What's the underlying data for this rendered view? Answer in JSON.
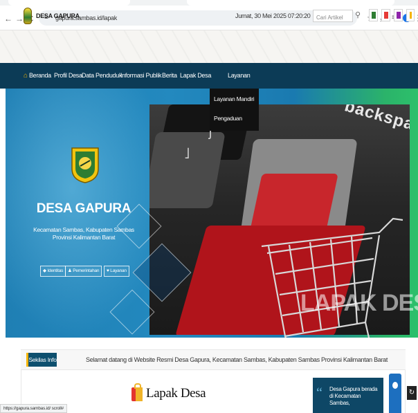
{
  "browser": {
    "url": "gapura.sambas.id/lapak",
    "status_url": "https://gapura.sambas.id/ scroll#",
    "nav": {
      "back": "←",
      "forward": "→",
      "reload": "C"
    },
    "site_icon": "≡"
  },
  "header": {
    "brand": "DESA GAPURA",
    "datetime": "Jumat, 30 Mei 2025  07:20:20",
    "search_placeholder": "Cari Artikel",
    "icon_colors": [
      "#2e7d32",
      "#e53935",
      "#8e24aa",
      "#f5b400"
    ]
  },
  "nav": {
    "items": [
      "Beranda",
      "Profil Desa",
      "Data Penduduk",
      "Informasi Publik",
      "Berita",
      "Lapak Desa",
      "Layanan"
    ],
    "dropdown": [
      "Layanan Mandiri",
      "Pengaduan"
    ]
  },
  "hero": {
    "title": "DESA GAPURA",
    "subtitle_line1": "Kecamatan Sambas, Kabupaten Sambas",
    "subtitle_line2": "Provinsi Kalimantan Barat",
    "buttons": [
      "Identitas",
      "Pemerintahan",
      "Layanan"
    ],
    "banner_text": "LAPAK DESA",
    "keyboard_text": "backspace"
  },
  "info": {
    "label": "Sekilas Info",
    "text": "Selamat datang di Website Resmi Desa Gapura, Kecamatan Sambas, Kabupaten Sambas Provinsi Kalimantan Barat"
  },
  "content": {
    "heading": "Lapak Desa",
    "side_text": "Desa Gapura berada di Kecamatan Sambas,"
  }
}
